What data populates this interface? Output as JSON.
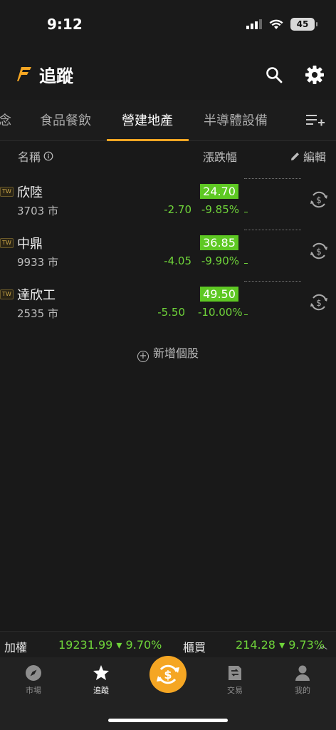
{
  "status_bar": {
    "time": "9:12",
    "battery": "45"
  },
  "header": {
    "title": "追蹤"
  },
  "tabs": [
    {
      "label": "念"
    },
    {
      "label": "食品餐飲"
    },
    {
      "label": "營建地產"
    },
    {
      "label": "半導體設備"
    }
  ],
  "active_tab": "營建地產",
  "columns": {
    "name": "名稱",
    "change": "漲跌幅",
    "edit": "編輯"
  },
  "stocks": [
    {
      "badge": "TW",
      "name": "欣陸",
      "code": "3703 市",
      "price": "24.70",
      "change": "-2.70",
      "pct": "-9.85%"
    },
    {
      "badge": "TW",
      "name": "中鼎",
      "code": "9933 市",
      "price": "36.85",
      "change": "-4.05",
      "pct": "-9.90%"
    },
    {
      "badge": "TW",
      "name": "達欣工",
      "code": "2535 市",
      "price": "49.50",
      "change": "-5.50",
      "pct": "-10.00%"
    }
  ],
  "add_stock": "新增個股",
  "ticker": {
    "label1": "加權",
    "value1": "19231.99 ▾ 9.70%",
    "label2": "櫃買",
    "value2": "214.28 ▾ 9.73%"
  },
  "nav": [
    {
      "label": "市場",
      "icon": "compass-icon"
    },
    {
      "label": "追蹤",
      "icon": "star-icon"
    },
    {
      "label": "",
      "icon": "dollar-exchange-icon"
    },
    {
      "label": "交易",
      "icon": "trade-doc-icon"
    },
    {
      "label": "我的",
      "icon": "person-icon"
    }
  ],
  "colors": {
    "accent": "#f5a623",
    "down_green": "#6fd43a",
    "price_bg": "#5ec823"
  }
}
